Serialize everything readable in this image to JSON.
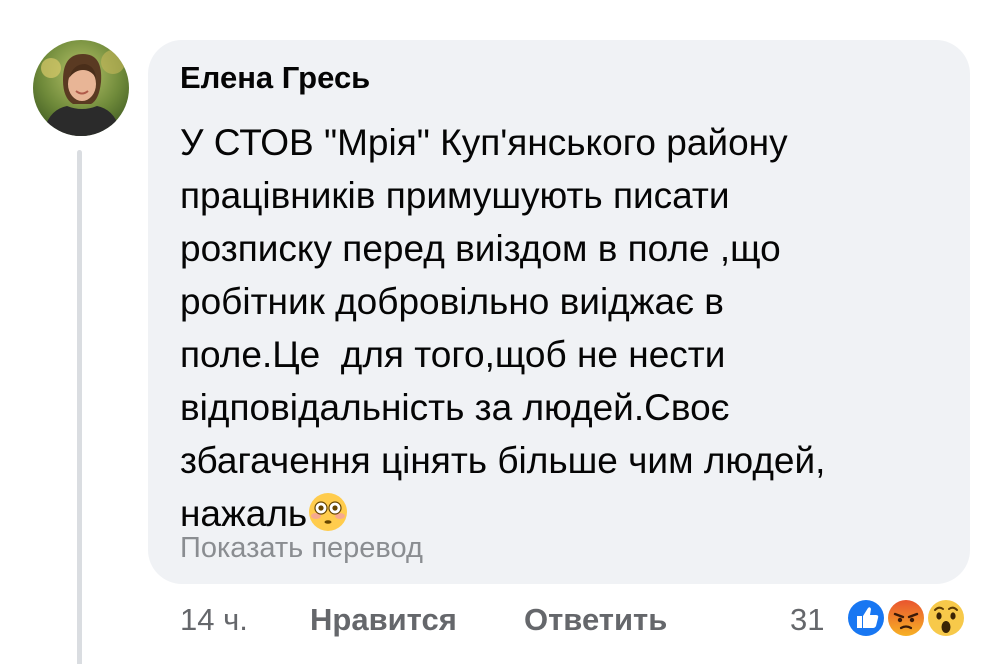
{
  "top_fragment": "···  ·········  ······",
  "comment": {
    "author": "Елена Гресь",
    "lines": [
      "У СТОВ \"Мрія\" Куп'янського району",
      "працівників примушують писати",
      "розписку перед виіздом в поле ,що",
      "робітник добровільно виіджає в",
      "поле.Це  для того,щоб не нести",
      "відповідальність за людей.Своє",
      "збагачення цінять більше чим людей,",
      "нажаль"
    ],
    "emoji": "flushed-face-emoji",
    "translate_label": "Показать перевод"
  },
  "actions": {
    "time": "14 ч.",
    "like_label": "Нравится",
    "reply_label": "Ответить"
  },
  "reactions": {
    "count": "31",
    "icons": [
      "like-reaction-icon",
      "angry-reaction-icon",
      "wow-reaction-icon"
    ]
  },
  "colors": {
    "bubble": "#f0f2f5",
    "text": "#050505",
    "secondary": "#65676b",
    "like_blue": "#1877f2"
  }
}
